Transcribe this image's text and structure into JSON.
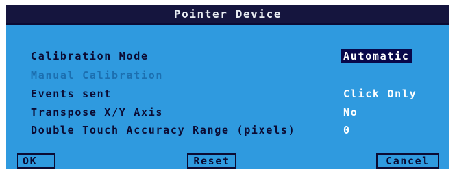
{
  "dialog": {
    "title": "Pointer Device"
  },
  "settings": [
    {
      "label": "Calibration Mode",
      "value": "Automatic",
      "disabled": false,
      "selected": true
    },
    {
      "label": "Manual Calibration",
      "value": "",
      "disabled": true,
      "selected": false
    },
    {
      "label": "Events sent",
      "value": "Click Only",
      "disabled": false,
      "selected": false
    },
    {
      "label": "Transpose X/Y Axis",
      "value": "No",
      "disabled": false,
      "selected": false
    },
    {
      "label": "Double Touch Accuracy Range (pixels)",
      "value": "0",
      "disabled": false,
      "selected": false
    }
  ],
  "buttons": {
    "ok": "OK",
    "reset": "Reset",
    "cancel": "Cancel"
  },
  "colors": {
    "title_bar": "#15153e",
    "panel": "#2f9adf",
    "text_dark": "#0b0b33",
    "text_disabled": "#1c6fb0",
    "value_text": "#ffffff",
    "selection_bg": "#08084a"
  }
}
